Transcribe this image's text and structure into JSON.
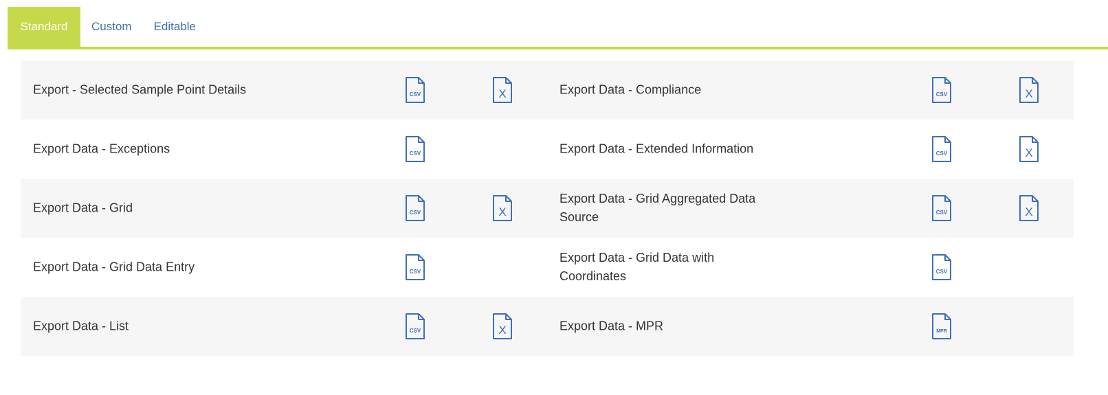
{
  "tabs": {
    "standard": "Standard",
    "custom": "Custom",
    "editable": "Editable"
  },
  "colors": {
    "accent": "#c6d94a",
    "link": "#3e6fb8",
    "row_shade": "#f6f6f6"
  },
  "icon_text": {
    "csv": "CSV",
    "mpr": "MPR",
    "excel": "X"
  },
  "exports": [
    {
      "label": "Export - Selected Sample Point Details",
      "icons": [
        "csv-file-icon",
        "excel-file-icon"
      ]
    },
    {
      "label": "Export Data - Compliance",
      "icons": [
        "csv-file-icon",
        "excel-file-icon"
      ]
    },
    {
      "label": "Export Data - Exceptions",
      "icons": [
        "csv-file-icon"
      ]
    },
    {
      "label": "Export Data - Extended Information",
      "icons": [
        "csv-file-icon",
        "excel-file-icon"
      ]
    },
    {
      "label": "Export Data - Grid",
      "icons": [
        "csv-file-icon",
        "excel-file-icon"
      ]
    },
    {
      "label": "Export Data - Grid Aggregated Data Source",
      "icons": [
        "csv-file-icon",
        "excel-file-icon"
      ]
    },
    {
      "label": "Export Data - Grid Data Entry",
      "icons": [
        "csv-file-icon"
      ]
    },
    {
      "label": "Export Data - Grid Data with Coordinates",
      "icons": [
        "csv-file-icon"
      ]
    },
    {
      "label": "Export Data - List",
      "icons": [
        "csv-file-icon",
        "excel-file-icon"
      ]
    },
    {
      "label": "Export Data - MPR",
      "icons": [
        "mpr-file-icon"
      ]
    }
  ]
}
